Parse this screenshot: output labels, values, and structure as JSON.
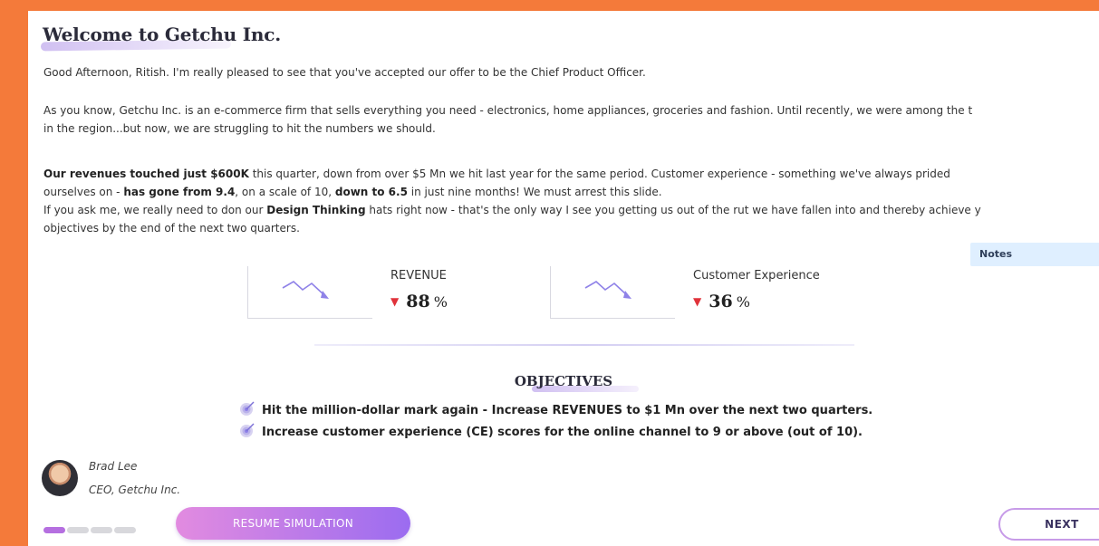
{
  "colors": {
    "background": "#f47a3a",
    "accent_purple": "#9b6cf0",
    "down_red": "#e0323a"
  },
  "title": "Welcome to Getchu Inc.",
  "paragraphs": {
    "greeting": "Good Afternoon, Ritish. I'm really pleased to see that you've accepted our offer to be the Chief Product Officer.",
    "intro_line1": "As you know, Getchu Inc. is an e-commerce firm that sells everything you need - electronics, home appliances, groceries and fashion. Until recently, we were among the t",
    "intro_line2": "in the region...but now, we are struggling to hit the numbers we should.",
    "rev_bold1": "Our revenues touched just $600K",
    "rev_text1": " this quarter, down from over $5 Mn we hit last year for the same period. Customer experience - something we've always prided",
    "rev_text2": "ourselves on - ",
    "rev_bold2": "has gone from 9.4",
    "rev_text3": ", on a scale of 10, ",
    "rev_bold3": "down to 6.5",
    "rev_text4": " in just nine months! We must arrest this slide.",
    "dt_text1": "If you ask me, we really need to don our ",
    "dt_bold": "Design Thinking",
    "dt_text2": " hats right now - that's the only way I see you getting us out of the rut we have fallen into and thereby achieve y",
    "dt_line2": "objectives by the end of the next two quarters."
  },
  "notes_tab": "Notes",
  "metrics": [
    {
      "label": "REVENUE",
      "value": "88",
      "unit": "%",
      "trend": "down",
      "icon": "trend-down-icon"
    },
    {
      "label": "Customer Experience",
      "value": "36",
      "unit": "%",
      "trend": "down",
      "icon": "trend-down-icon"
    }
  ],
  "objectives": {
    "title": "OBJECTIVES",
    "items": [
      "Hit the million-dollar mark again - Increase REVENUES to $1 Mn over the next two quarters.",
      "Increase customer experience (CE) scores for the online channel to 9 or above (out of 10)."
    ],
    "icon": "target-icon"
  },
  "signature": {
    "name": "Brad Lee",
    "role": "CEO, Getchu Inc."
  },
  "progress": {
    "total_steps": 4,
    "current_step": 1
  },
  "buttons": {
    "resume": "RESUME SIMULATION",
    "next": "NEXT"
  }
}
